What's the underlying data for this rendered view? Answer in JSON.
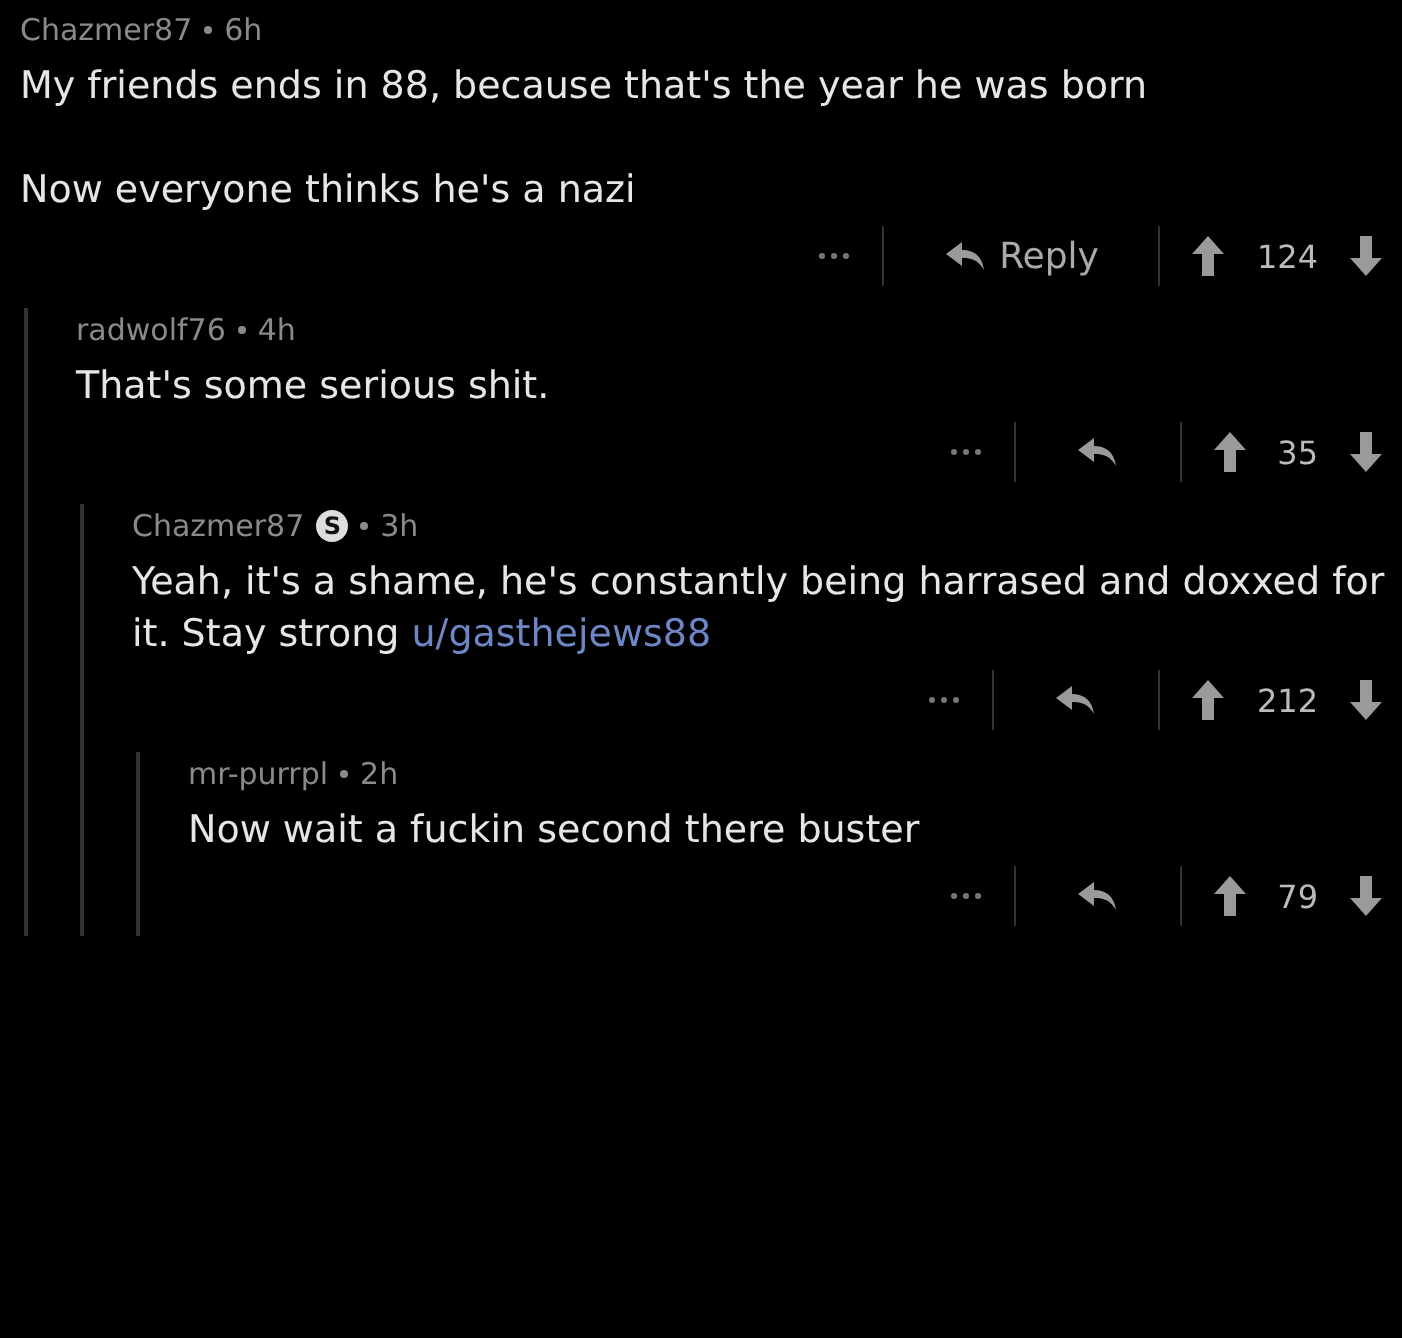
{
  "comments": [
    {
      "author": "Chazmer87",
      "time": "6h",
      "paragraphs": [
        {
          "text": "My friends ends in 88, because that's the year he was born"
        },
        {
          "text": "Now everyone thinks he's a nazi"
        }
      ],
      "reply_label": "Reply",
      "score": "124",
      "children": [
        {
          "author": "radwolf76",
          "time": "4h",
          "paragraphs": [
            {
              "text": "That's some serious shit."
            }
          ],
          "score": "35",
          "children": [
            {
              "author": "Chazmer87",
              "badge": "S",
              "time": "3h",
              "paragraphs": [
                {
                  "text": "Yeah, it's a shame, he's constantly being harrased and doxxed for it.  Stay strong ",
                  "link": "u/gasthejews88"
                }
              ],
              "score": "212",
              "children": [
                {
                  "author": "mr-purrpl",
                  "time": "2h",
                  "paragraphs": [
                    {
                      "text": "Now wait a fuckin second there buster"
                    }
                  ],
                  "score": "79"
                }
              ]
            }
          ]
        }
      ]
    }
  ]
}
